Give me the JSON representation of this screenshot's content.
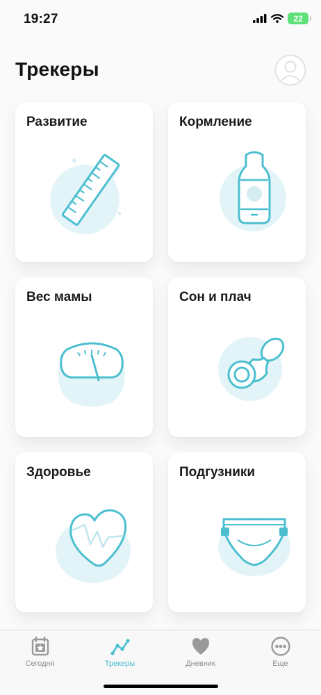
{
  "status_bar": {
    "time": "19:27",
    "battery": "22"
  },
  "header": {
    "title": "Трекеры"
  },
  "trackers": [
    {
      "title": "Развитие",
      "icon": "ruler-icon"
    },
    {
      "title": "Кормление",
      "icon": "baby-bottle-icon"
    },
    {
      "title": "Вес мамы",
      "icon": "scale-icon"
    },
    {
      "title": "Сон и плач",
      "icon": "pacifier-icon"
    },
    {
      "title": "Здоровье",
      "icon": "heart-pulse-icon"
    },
    {
      "title": "Подгузники",
      "icon": "diaper-icon"
    }
  ],
  "tab_bar": {
    "active": "Трекеры",
    "tabs": [
      {
        "label": "Сегодня",
        "icon": "calendar-star-icon"
      },
      {
        "label": "Трекеры",
        "icon": "chart-line-icon"
      },
      {
        "label": "Дневник",
        "icon": "heart-icon"
      },
      {
        "label": "Еще",
        "icon": "more-dots-icon"
      }
    ]
  },
  "colors": {
    "accent": "#4bbfd0",
    "accent_light": "#e3f4f8",
    "tab_inactive": "#8e8e8e",
    "background": "#fafafa"
  }
}
